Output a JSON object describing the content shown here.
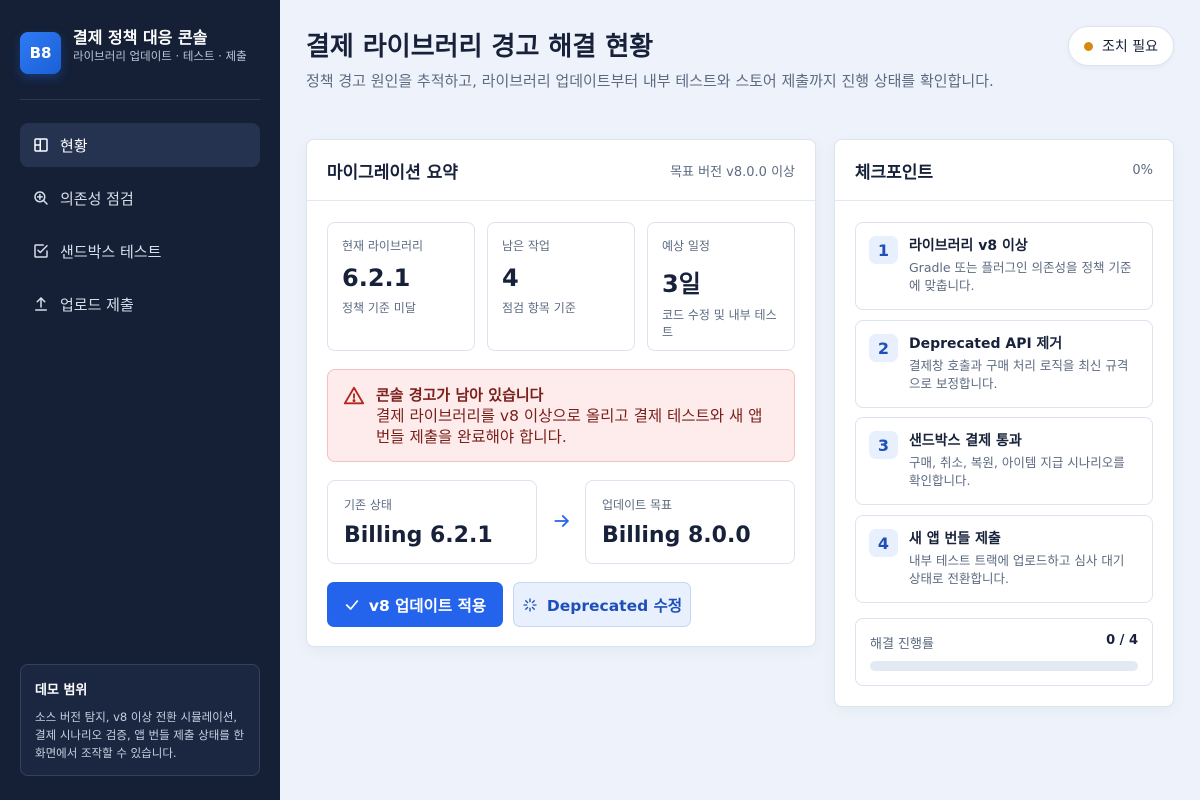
{
  "sidebar": {
    "logo": "B8",
    "title": "결제 정책 대응 콘솔",
    "subtitle": "라이브러리 업데이트 · 테스트 · 제출",
    "items": [
      {
        "label": "현황",
        "icon": "layout-icon",
        "active": true
      },
      {
        "label": "의존성 점검",
        "icon": "search-plus-icon",
        "active": false
      },
      {
        "label": "샌드박스 테스트",
        "icon": "check-square-icon",
        "active": false
      },
      {
        "label": "업로드 제출",
        "icon": "upload-icon",
        "active": false
      }
    ],
    "demo": {
      "title": "데모 범위",
      "text": "소스 버전 탐지, v8 이상 전환 시뮬레이션, 결제 시나리오 검증, 앱 번들 제출 상태를 한 화면에서 조작할 수 있습니다."
    }
  },
  "header": {
    "title": "결제 라이브러리 경고 해결 현황",
    "description": "정책 경고 원인을 추적하고, 라이브러리 업데이트부터 내부 테스트와 스토어 제출까지 진행 상태를 확인합니다.",
    "status": "조치 필요",
    "status_color": "#d48a12"
  },
  "summary": {
    "title": "마이그레이션 요약",
    "target": "목표 버전 v8.0.0 이상",
    "stats": [
      {
        "label": "현재 라이브러리",
        "value": "6.2.1",
        "note": "정책 기준 미달"
      },
      {
        "label": "남은 작업",
        "value": "4",
        "note": "점검 항목 기준"
      },
      {
        "label": "예상 일정",
        "value": "3일",
        "note": "코드 수정 및 내부 테스트"
      }
    ],
    "alert": {
      "title": "콘솔 경고가 남아 있습니다",
      "text": "결제 라이브러리를 v8 이상으로 올리고 결제 테스트와 새 앱 번들 제출을 완료해야 합니다."
    },
    "from": {
      "label": "기존 상태",
      "value": "Billing 6.2.1"
    },
    "to": {
      "label": "업데이트 목표",
      "value": "Billing 8.0.0"
    },
    "primary_button": "v8 업데이트 적용",
    "secondary_button": "Deprecated 수정"
  },
  "checkpoints": {
    "title": "체크포인트",
    "percent": "0%",
    "items": [
      {
        "num": "1",
        "title": "라이브러리 v8 이상",
        "desc": "Gradle 또는 플러그인 의존성을 정책 기준에 맞춥니다."
      },
      {
        "num": "2",
        "title": "Deprecated API 제거",
        "desc": "결제창 호출과 구매 처리 로직을 최신 규격으로 보정합니다."
      },
      {
        "num": "3",
        "title": "샌드박스 결제 통과",
        "desc": "구매, 취소, 복원, 아이템 지급 시나리오를 확인합니다."
      },
      {
        "num": "4",
        "title": "새 앱 번들 제출",
        "desc": "내부 테스트 트랙에 업로드하고 심사 대기 상태로 전환합니다."
      }
    ],
    "progress_label": "해결 진행률",
    "progress_count": "0 / 4",
    "progress_value": 0
  }
}
